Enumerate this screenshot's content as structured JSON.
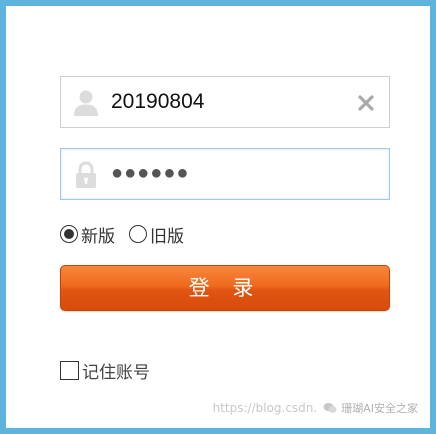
{
  "login": {
    "username": {
      "value": "20190804",
      "icon": "user-icon",
      "clear_icon": "close-icon"
    },
    "password": {
      "value": "●●●●●●",
      "icon": "lock-icon"
    },
    "version_options": [
      {
        "label": "新版",
        "checked": true
      },
      {
        "label": "旧版",
        "checked": false
      }
    ],
    "login_button_label": "登 录",
    "remember_label": "记住账号",
    "remember_checked": false
  },
  "watermark": {
    "url_text": "https://blog.csdn.",
    "brand_text": "珊瑚AI安全之家"
  },
  "colors": {
    "frame_border": "#5db4dc",
    "button_orange": "#e8601a",
    "field_border": "#cfcfcf",
    "field_focus_border": "#9ec9e7"
  }
}
